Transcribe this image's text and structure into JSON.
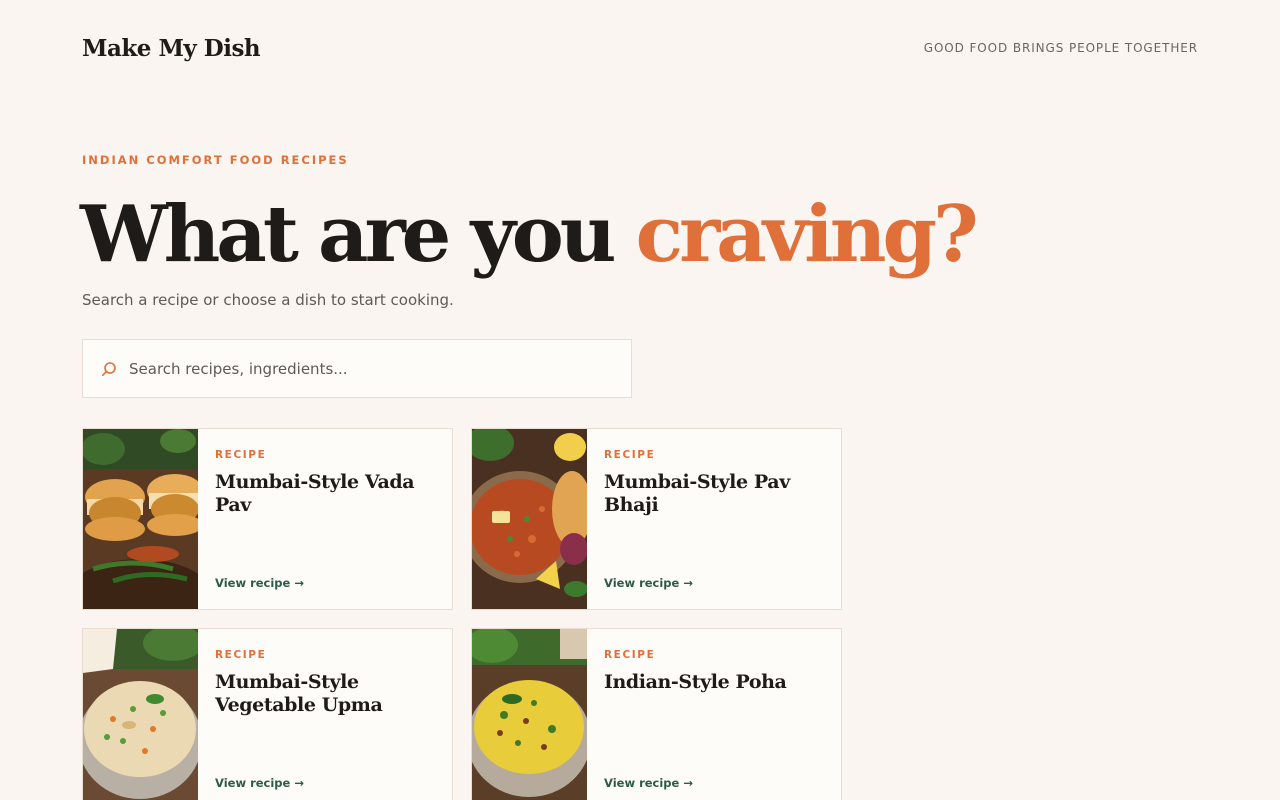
{
  "header": {
    "brand": "Make My Dish",
    "tagline": "GOOD FOOD BRINGS PEOPLE TOGETHER"
  },
  "hero": {
    "eyebrow": "INDIAN COMFORT FOOD RECIPES",
    "headline_main": "What are you",
    "headline_accent": "craving?",
    "subheading": "Search a recipe or choose a dish to start cooking."
  },
  "search": {
    "placeholder": "Search recipes, ingredients...",
    "value": "",
    "icon": "search-icon"
  },
  "recipes": [
    {
      "label": "RECIPE",
      "title": "Mumbai-Style Vada Pav",
      "link": "View recipe →",
      "image": "vada-pav-photo"
    },
    {
      "label": "RECIPE",
      "title": "Mumbai-Style Pav Bhaji",
      "link": "View recipe →",
      "image": "pav-bhaji-photo"
    },
    {
      "label": "RECIPE",
      "title": "Mumbai-Style Vegetable Upma",
      "link": "View recipe →",
      "image": "vegetable-upma-photo"
    },
    {
      "label": "RECIPE",
      "title": "Indian-Style Poha",
      "link": "View recipe →",
      "image": "poha-photo"
    }
  ],
  "colors": {
    "background": "#faf5f0",
    "accent": "#e0703a",
    "text": "#1e1b18",
    "link": "#2e5a46",
    "border": "#e9ddd2"
  }
}
